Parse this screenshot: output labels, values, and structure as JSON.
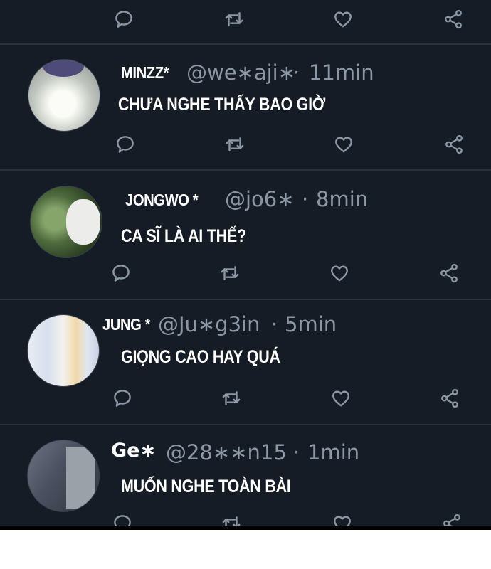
{
  "icons": [
    "reply-icon",
    "retweet-icon",
    "like-icon",
    "share-icon"
  ],
  "comments": [
    {
      "name": "MINZZ*",
      "handle": "@we∗aji∗",
      "separator": "·",
      "time": "11min",
      "text": "CHƯA NGHE THẤY BAO GIỜ"
    },
    {
      "name": "JONGWO *",
      "handle": "@jo6∗",
      "separator": "·",
      "time": "8min",
      "text": "CA SĨ LÀ AI THẾ?"
    },
    {
      "name": "JUNG *",
      "handle": "@Ju∗g3in",
      "separator": "·",
      "time": "5min",
      "text": "GIỌNG CAO HAY QUÁ"
    },
    {
      "name": "Ge∗",
      "handle": "@28∗∗n15",
      "separator": "·",
      "time": "1min",
      "text": "MUỐN NGHE TOÀN BÀI"
    }
  ]
}
